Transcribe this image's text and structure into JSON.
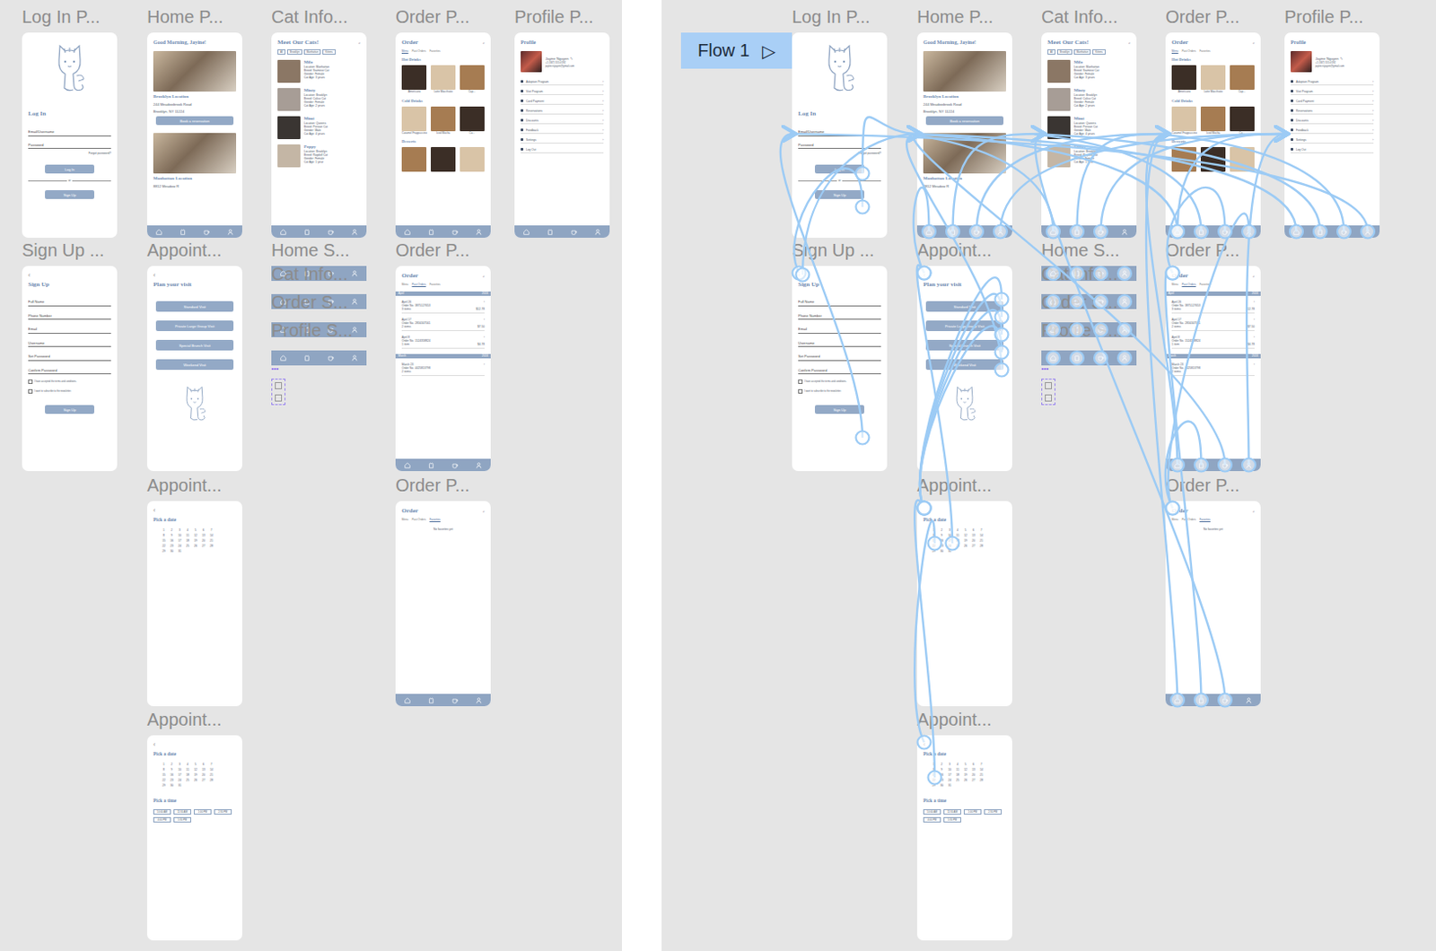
{
  "screens": [
    {
      "label": "Log In P...",
      "kind": "login",
      "title": "Log In",
      "fields": [
        "Email/Username",
        "Password"
      ],
      "link": "Forgot password?",
      "primary": "Log In",
      "divider": "or",
      "secondary": "Sign Up"
    },
    {
      "label": "Sign Up ...",
      "kind": "signup",
      "back": "‹",
      "title": "Sign Up",
      "fields": [
        "Full Name",
        "Phone Number",
        "Email",
        "Username",
        "Set Password",
        "Confirm Password"
      ],
      "checks": [
        {
          "text": "I have accepted the terms and conditions.",
          "checked": false
        },
        {
          "text": "I want to subscribe to the newsletter.",
          "checked": false
        }
      ],
      "primary": "Sign Up"
    },
    {
      "label": "Home P...",
      "kind": "home",
      "title": "Good Morning, Jayine!",
      "locations": [
        {
          "name": "Brooklyn Location",
          "lines": [
            "244 Meadowbrook Road",
            "Brooklyn, NY 11224"
          ],
          "button": "Book a reservation"
        },
        {
          "name": "Manhattan Location",
          "lines": [
            "8812 Meadow R"
          ]
        }
      ]
    },
    {
      "label": "Appoint...",
      "kind": "visits",
      "back": "‹",
      "title": "Plan your visit",
      "options": [
        "Standard Visit",
        "Private Large Group Visit",
        "Special Brunch Visit",
        "Weekend Visit"
      ]
    },
    {
      "label": "Appoint...",
      "kind": "calendar",
      "back": "‹",
      "title": "Pick a date",
      "days": [
        "1",
        "2",
        "3",
        "4",
        "5",
        "6",
        "7",
        "8",
        "9",
        "10",
        "11",
        "12",
        "13",
        "14",
        "15",
        "16",
        "17",
        "18",
        "19",
        "20",
        "21",
        "22",
        "23",
        "24",
        "25",
        "26",
        "27",
        "28",
        "29",
        "30",
        "31"
      ]
    },
    {
      "label": "Appoint...",
      "kind": "calendar",
      "back": "‹",
      "title": "Pick a date",
      "days": [
        "1",
        "2",
        "3",
        "4",
        "5",
        "6",
        "7",
        "8",
        "9",
        "10",
        "11",
        "12",
        "13",
        "14",
        "15",
        "16",
        "17",
        "18",
        "19",
        "20",
        "21",
        "22",
        "23",
        "24",
        "25",
        "26",
        "27",
        "28",
        "29",
        "30",
        "31"
      ],
      "time_title": "Pick a time",
      "times": [
        "10:00 AM",
        "11:30 AM",
        "1:00 PM",
        "2:30 PM",
        "4:00 PM",
        "5:30 PM"
      ]
    },
    {
      "label": "Cat Info...",
      "kind": "cats",
      "title": "Meet Our Cats!",
      "icon": "⌕",
      "chips": [
        "All",
        "Brooklyn",
        "Manhattan",
        "Kittens"
      ],
      "cats": [
        {
          "name": "Milo",
          "details": [
            "Location: Manhattan",
            "Breed: Siamese Cat",
            "Gender: Female",
            "Cat Age: 3 years"
          ]
        },
        {
          "name": "Minty",
          "details": [
            "Location: Brooklyn",
            "Breed: Calico Cat",
            "Gender: Female",
            "Cat Age: 2 years"
          ]
        },
        {
          "name": "Mimi",
          "details": [
            "Location: Queens",
            "Breed: Persian Cat",
            "Gender: Male",
            "Cat Age: 4 years"
          ]
        },
        {
          "name": "Poppy",
          "details": [
            "Location: Brooklyn",
            "Breed: Ragdoll Cat",
            "Gender: Female",
            "Cat Age: 1 year"
          ]
        }
      ]
    },
    {
      "label": "Order P...",
      "kind": "menu",
      "title": "Order",
      "icon": "⌕",
      "tabs": [
        {
          "label": "Menu",
          "selected": true
        },
        {
          "label": "Past Orders",
          "selected": false
        },
        {
          "label": "Favorites",
          "selected": false
        }
      ],
      "sections": [
        {
          "title": "Hot Drinks",
          "items": [
            "Americano",
            "Latte Macchiato",
            "Cap..."
          ]
        },
        {
          "title": "Cold Drinks",
          "items": [
            "Caramel Frappuccino",
            "Iced Mocha",
            "Co..."
          ]
        },
        {
          "title": "Desserts",
          "items": [
            "",
            "",
            ""
          ]
        }
      ]
    },
    {
      "label": "Order P...",
      "kind": "history",
      "title": "Order",
      "icon": "⌕",
      "chevron": "›",
      "tabs": [
        {
          "label": "Menu",
          "selected": false
        },
        {
          "label": "Past Orders",
          "selected": true
        },
        {
          "label": "Favorites",
          "selected": false
        }
      ],
      "months": [
        {
          "month": "April",
          "year": "2024",
          "orders": [
            {
              "date": "April 26",
              "number": "Order No. 3875127653",
              "items": "3 items",
              "total": "$12.78"
            },
            {
              "date": "April 17",
              "number": "Order No. 2856347561",
              "items": "2 items",
              "total": "$7.50"
            },
            {
              "date": "April 8",
              "number": "Order No. 1524358824",
              "items": "1 item",
              "total": "$4.78"
            }
          ]
        },
        {
          "month": "March",
          "year": "2024",
          "orders": [
            {
              "date": "March 23",
              "number": "Order No. 4425813798",
              "items": "2 items",
              "total": ""
            }
          ]
        }
      ]
    },
    {
      "label": "Order P...",
      "kind": "empty",
      "title": "Order",
      "icon": "⌕",
      "tabs": [
        {
          "label": "Menu",
          "selected": false
        },
        {
          "label": "Past Orders",
          "selected": false
        },
        {
          "label": "Favorites",
          "selected": true
        }
      ],
      "message": "No favorites yet"
    },
    {
      "label": "Profile P...",
      "kind": "profile",
      "title": "Profile",
      "name": "Jayine Nguyen",
      "edit": "✎",
      "chevron": "›",
      "lines": [
        "+1 (347) 555-0192",
        "jayine.nguyen@gmail.com"
      ],
      "items": [
        {
          "text": "Adoption Program",
          "arrow": true
        },
        {
          "text": "Visit Program",
          "arrow": true
        },
        {
          "text": "Card Payment",
          "arrow": true
        },
        {
          "text": "Reservations",
          "arrow": true
        },
        {
          "text": "Discounts",
          "arrow": true
        },
        {
          "text": "Feedback",
          "arrow": true
        },
        {
          "text": "Settings",
          "arrow": true
        },
        {
          "text": "Log Out",
          "arrow": false
        }
      ]
    }
  ],
  "components": {
    "labels": [
      "Home S...",
      "Cat Info...",
      "Order S...",
      "Profile S..."
    ],
    "dots": "•••"
  },
  "flow": {
    "label": "Flow 1",
    "icon": "▷"
  },
  "connections": [
    {
      "from": 0,
      "to": 2
    },
    {
      "from": 0,
      "to": 1
    },
    {
      "from": 1,
      "to": 0
    },
    {
      "from": 1,
      "to": 2
    },
    {
      "from": 2,
      "to": 3
    },
    {
      "from": 2,
      "to": 6
    },
    {
      "from": 2,
      "to": 7
    },
    {
      "from": 2,
      "to": 10
    },
    {
      "from": 3,
      "to": 4
    },
    {
      "from": 3,
      "to": 4
    },
    {
      "from": 3,
      "to": 4
    },
    {
      "from": 3,
      "to": 4
    },
    {
      "from": 3,
      "to": 2
    },
    {
      "from": 4,
      "to": 5
    },
    {
      "from": 4,
      "to": 3
    },
    {
      "from": 5,
      "to": 4
    },
    {
      "from": 6,
      "to": 2
    },
    {
      "from": 6,
      "to": 7
    },
    {
      "from": 6,
      "to": 10
    },
    {
      "from": 7,
      "to": 2
    },
    {
      "from": 7,
      "to": 6
    },
    {
      "from": 7,
      "to": 8
    },
    {
      "from": 7,
      "to": 9
    },
    {
      "from": 7,
      "to": 10
    },
    {
      "from": 8,
      "to": 7
    },
    {
      "from": 8,
      "to": 9
    },
    {
      "from": 8,
      "to": 2
    },
    {
      "from": 8,
      "to": 10
    },
    {
      "from": 9,
      "to": 7
    },
    {
      "from": 9,
      "to": 8
    },
    {
      "from": 9,
      "to": 6
    },
    {
      "from": 10,
      "to": 2
    },
    {
      "from": 10,
      "to": 6
    },
    {
      "from": 10,
      "to": 7
    },
    {
      "from": 10,
      "to": 0
    }
  ]
}
